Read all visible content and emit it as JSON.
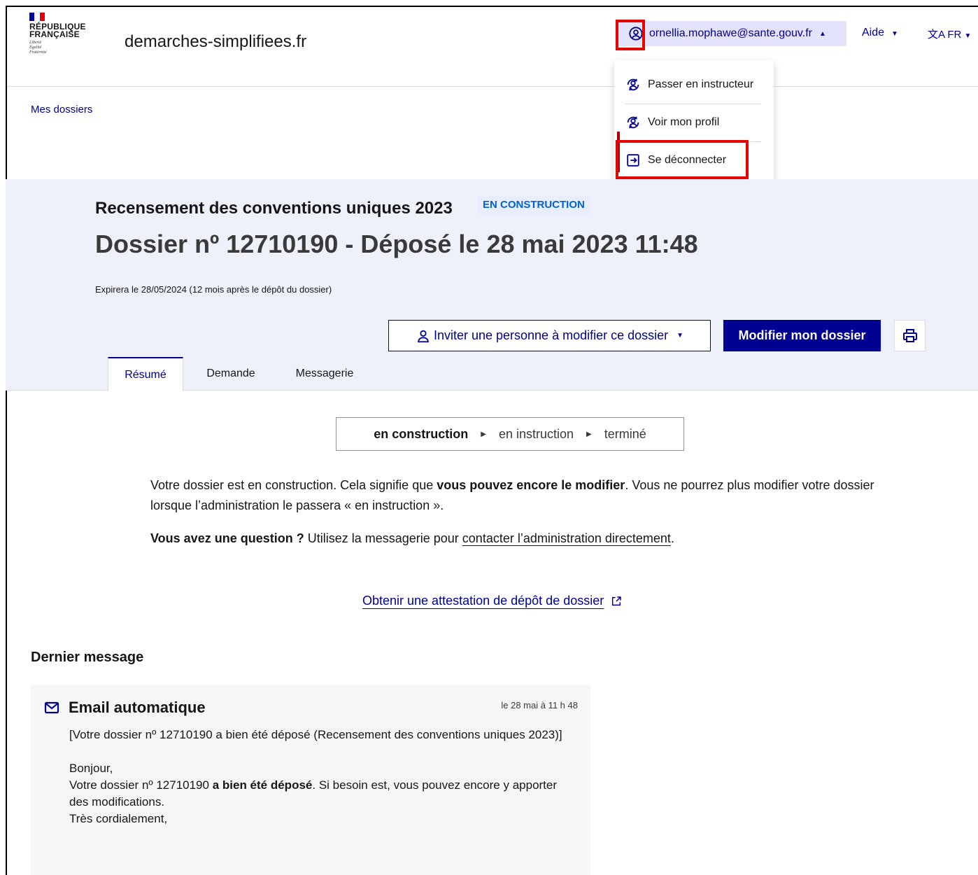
{
  "header": {
    "logo_line1": "RÉPUBLIQUE",
    "logo_line2": "FRANÇAISE",
    "motto_1": "Liberté",
    "motto_2": "Égalité",
    "motto_3": "Fraternité",
    "site_name": "demarches-simplifiees.fr",
    "user_email": "ornellia.mophawe@sante.gouv.fr",
    "aide_label": "Aide",
    "lang_label": "FR"
  },
  "user_menu": {
    "items": [
      {
        "label": "Passer en instructeur",
        "icon": "user-switch-icon"
      },
      {
        "label": "Voir mon profil",
        "icon": "user-switch-icon"
      },
      {
        "label": "Se déconnecter",
        "icon": "logout-icon"
      }
    ]
  },
  "breadcrumb": {
    "mes_dossiers": "Mes dossiers"
  },
  "dossier": {
    "demarche": "Recensement des conventions uniques 2023",
    "status_badge": "EN CONSTRUCTION",
    "title": "Dossier nº 12710190 - Déposé le 28 mai 2023 11:48",
    "expire": "Expirera le 28/05/2024 (12 mois après le dépôt du dossier)"
  },
  "actions": {
    "invite_label": "Inviter une personne à modifier ce dossier",
    "modify_label": "Modifier mon dossier"
  },
  "tabs": [
    {
      "label": "Résumé",
      "active": true
    },
    {
      "label": "Demande",
      "active": false
    },
    {
      "label": "Messagerie",
      "active": false
    }
  ],
  "status_steps": [
    "en construction",
    "en instruction",
    "terminé"
  ],
  "info": {
    "p1_a": "Votre dossier est en construction. Cela signifie que ",
    "p1_b": "vous pouvez encore le modifier",
    "p1_c": ". Vous ne pourrez plus modifier votre dossier lorsque l’administration le passera « en instruction ».",
    "p2_a": "Vous avez une question ?",
    "p2_b": " Utilisez la messagerie pour ",
    "p2_link": "contacter l’administration directement",
    "p2_c": "."
  },
  "attestation_link": "Obtenir une attestation de dépôt de dossier",
  "last_message": {
    "heading": "Dernier message",
    "sender": "Email automatique",
    "date": "le 28 mai à 11 h 48",
    "subject": "[Votre dossier nº 12710190 a bien été déposé (Recensement des conventions uniques 2023)]",
    "greeting": "Bonjour,",
    "body_a": "Votre dossier nº 12710190 ",
    "body_b": "a bien été déposé",
    "body_c": ". Si besoin est, vous pouvez encore y apporter des modifications.",
    "closing": "Très cordialement,"
  },
  "colors": {
    "brand_blue": "#000091",
    "highlight_red": "#e10600",
    "band_bg": "#eef1fa"
  }
}
